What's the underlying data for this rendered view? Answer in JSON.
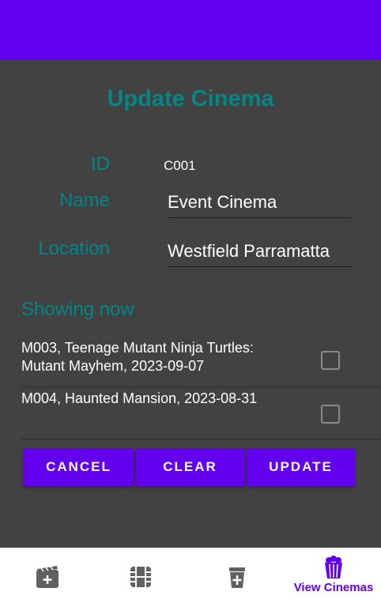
{
  "screen": {
    "title": "Update Cinema"
  },
  "form": {
    "id_label": "ID",
    "id_value": "C001",
    "name_label": "Name",
    "name_value": "Event Cinema",
    "location_label": "Location",
    "location_value": "Westfield Parramatta"
  },
  "showing": {
    "title": "Showing now",
    "movies": [
      {
        "text": "M003, Teenage Mutant Ninja Turtles: Mutant Mayhem, 2023-09-07",
        "checked": false
      },
      {
        "text": "M004, Haunted Mansion, 2023-08-31",
        "checked": false
      }
    ]
  },
  "buttons": {
    "cancel": "CANCEL",
    "clear": "CLEAR",
    "update": "UPDATE"
  },
  "bottom_nav": {
    "items": [
      {
        "icon": "add-movie-icon",
        "label": ""
      },
      {
        "icon": "film-icon",
        "label": ""
      },
      {
        "icon": "add-drink-icon",
        "label": ""
      },
      {
        "icon": "popcorn-icon",
        "label": "View Cinemas",
        "active": true
      }
    ]
  },
  "colors": {
    "primary": "#6200EE",
    "accent": "#018786",
    "background": "#424242",
    "nav_icon_inactive": "#616161"
  }
}
